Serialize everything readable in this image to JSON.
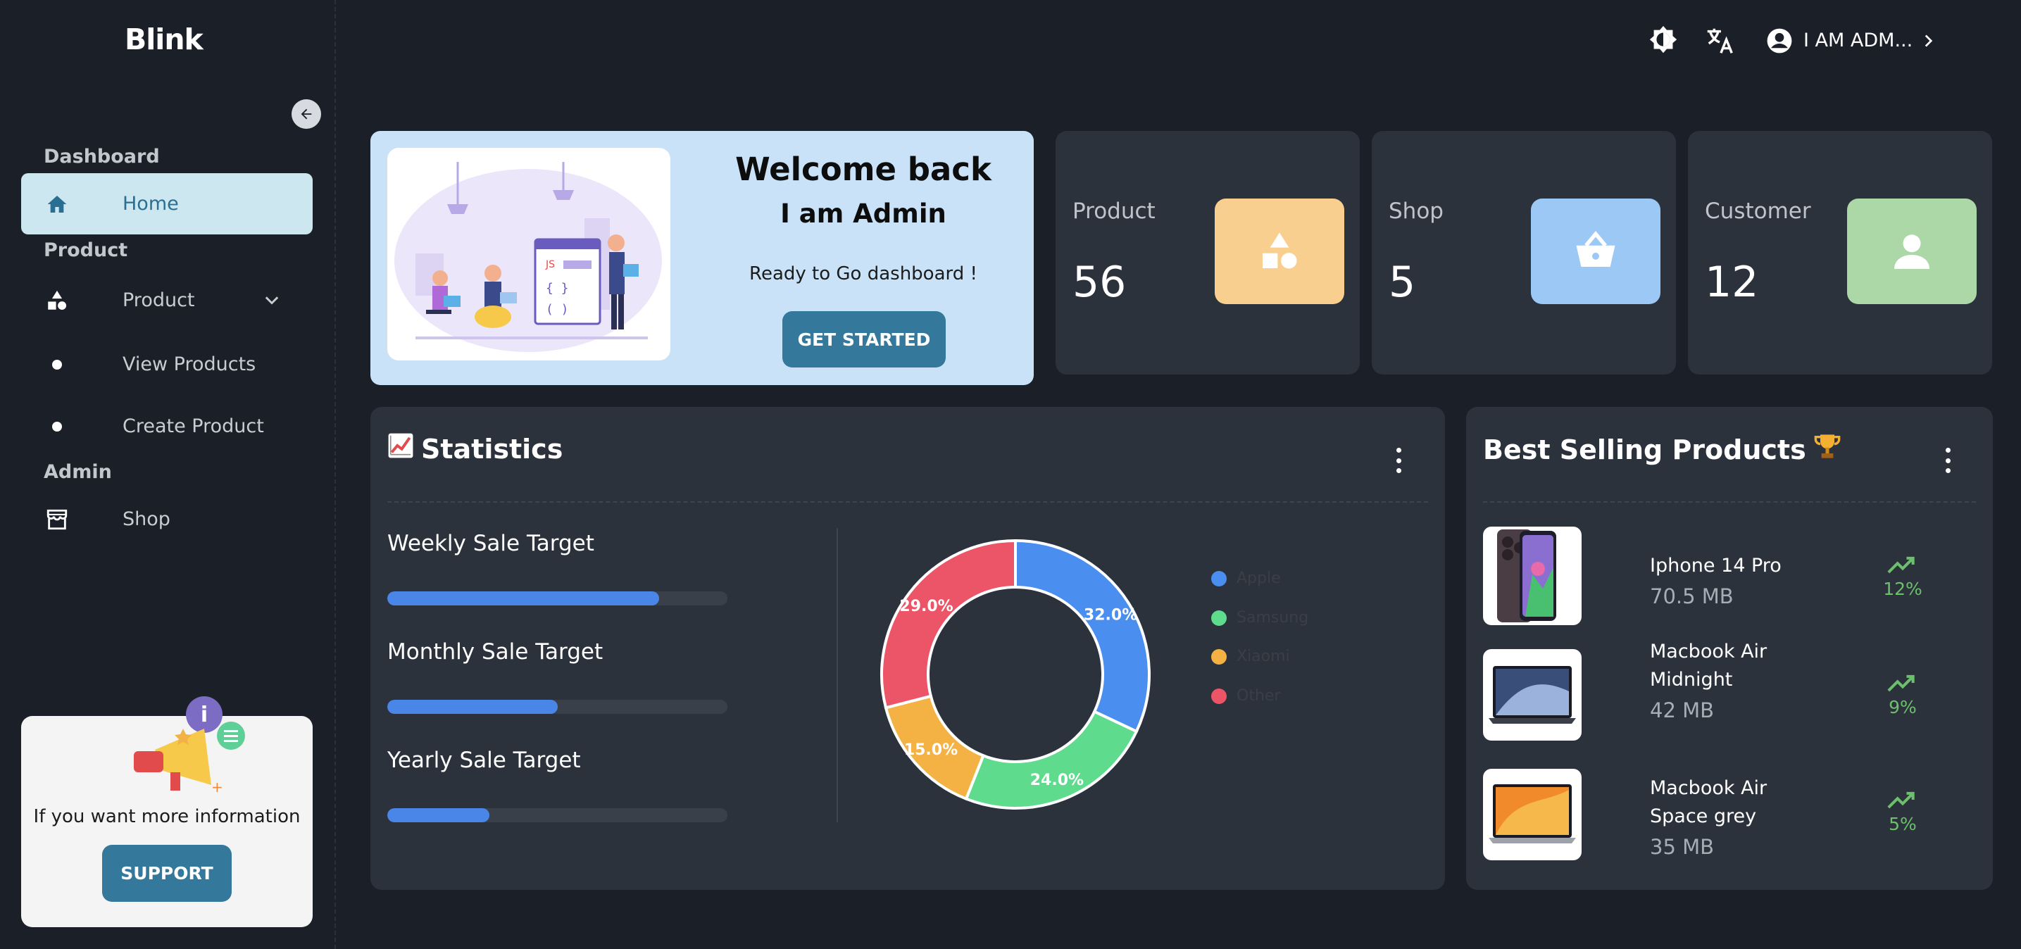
{
  "brand": "Blink",
  "sidebar": {
    "sections": [
      {
        "label": "Dashboard"
      },
      {
        "label": "Product"
      },
      {
        "label": "Admin"
      }
    ],
    "items": [
      {
        "label": "Home",
        "icon": "home-icon",
        "active": true
      },
      {
        "label": "Product",
        "icon": "shapes-icon"
      },
      {
        "label": "View Products",
        "icon": "dot-icon"
      },
      {
        "label": "Create Product",
        "icon": "dot-icon"
      },
      {
        "label": "Shop",
        "icon": "store-icon"
      }
    ],
    "support": {
      "text": "If you want more information",
      "button": "SUPPORT"
    }
  },
  "topbar": {
    "user_label": "I AM ADM..."
  },
  "welcome": {
    "title": "Welcome back",
    "subtitle": "I am Admin",
    "description": "Ready to Go dashboard !",
    "button": "GET STARTED"
  },
  "stats": [
    {
      "label": "Product",
      "value": "56",
      "color": "#f9cf8f",
      "icon": "shapes-icon"
    },
    {
      "label": "Shop",
      "value": "5",
      "color": "#9bc8f5",
      "icon": "basket-icon"
    },
    {
      "label": "Customer",
      "value": "12",
      "color": "#acd8a8",
      "icon": "person-icon"
    }
  ],
  "statistics": {
    "title": "Statistics",
    "icon": "chart-up-icon",
    "targets": [
      {
        "label": "Weekly Sale Target",
        "progress": 0.8
      },
      {
        "label": "Monthly Sale Target",
        "progress": 0.5
      },
      {
        "label": "Yearly Sale Target",
        "progress": 0.3
      }
    ]
  },
  "chart_data": {
    "type": "pie",
    "categories": [
      "Apple",
      "Samsung",
      "Xiaomi",
      "Other"
    ],
    "values": [
      32.0,
      24.0,
      15.0,
      29.0
    ],
    "labels": [
      "32.0%",
      "24.0%",
      "15.0%",
      "29.0%"
    ],
    "colors": [
      "#4a8ef0",
      "#5fdb8e",
      "#f4b245",
      "#ec5467"
    ],
    "donut": true,
    "legend": "right"
  },
  "best_selling": {
    "title": "Best Selling Products",
    "icon": "trophy-icon",
    "products": [
      {
        "name": "Iphone 14 Pro",
        "size": "70.5 MB",
        "growth": "12%"
      },
      {
        "name": "Macbook Air Midnight",
        "size": "42 MB",
        "growth": "9%"
      },
      {
        "name": "Macbook Air Space grey",
        "size": "35 MB",
        "growth": "5%"
      }
    ]
  }
}
